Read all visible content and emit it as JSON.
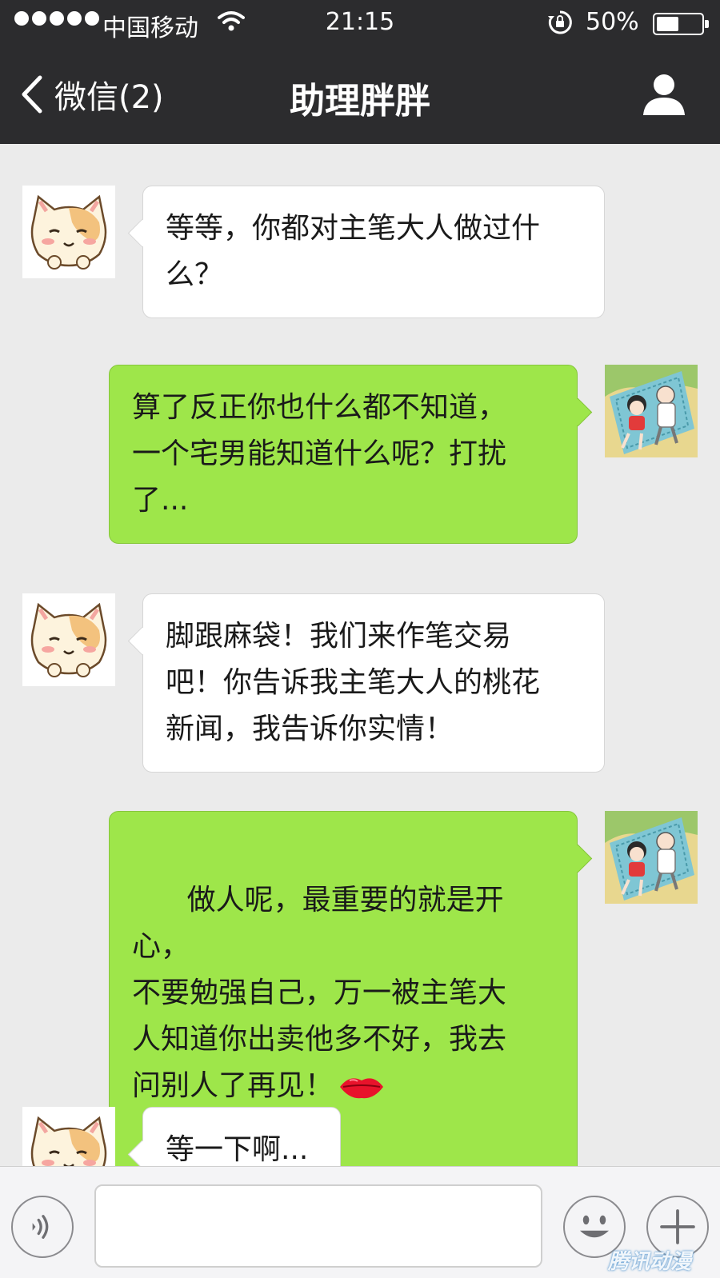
{
  "status_bar": {
    "carrier": "中国移动",
    "time": "21:15",
    "battery_percent": "50%",
    "battery_level": 0.5,
    "icons": [
      "signal-dots-icon",
      "wifi-icon",
      "rotation-lock-icon",
      "battery-icon"
    ]
  },
  "nav": {
    "back_label": "微信(2)",
    "title": "助理胖胖",
    "icons": [
      "chevron-left-icon",
      "profile-icon"
    ]
  },
  "messages": [
    {
      "sender": "contact",
      "avatar": "cat-avatar",
      "text": "等等，你都对主笔大人做过什\n么？"
    },
    {
      "sender": "me",
      "avatar": "cartoon-avatar",
      "text": "算了反正你也什么都不知道，\n一个宅男能知道什么呢？打扰\n了..."
    },
    {
      "sender": "contact",
      "avatar": "cat-avatar",
      "text": "脚跟麻袋！我们来作笔交易\n吧！你告诉我主笔大人的桃花\n新闻，我告诉你实情！"
    },
    {
      "sender": "me",
      "avatar": "cartoon-avatar",
      "text": "做人呢，最重要的就是开心，\n不要勉强自己，万一被主笔大\n人知道你出卖他多不好，我去\n问别人了再见！",
      "emoji": "lips-emoji"
    },
    {
      "sender": "contact",
      "avatar": "cat-avatar",
      "text": "等一下啊..."
    }
  ],
  "input_bar": {
    "input_value": "",
    "icons": [
      "voice-icon",
      "emoji-smile-icon",
      "plus-icon"
    ]
  },
  "colors": {
    "bar_background": "#2c2c2e",
    "chat_background": "#ebebeb",
    "outgoing_bubble": "#9ee64a",
    "incoming_bubble": "#ffffff"
  }
}
